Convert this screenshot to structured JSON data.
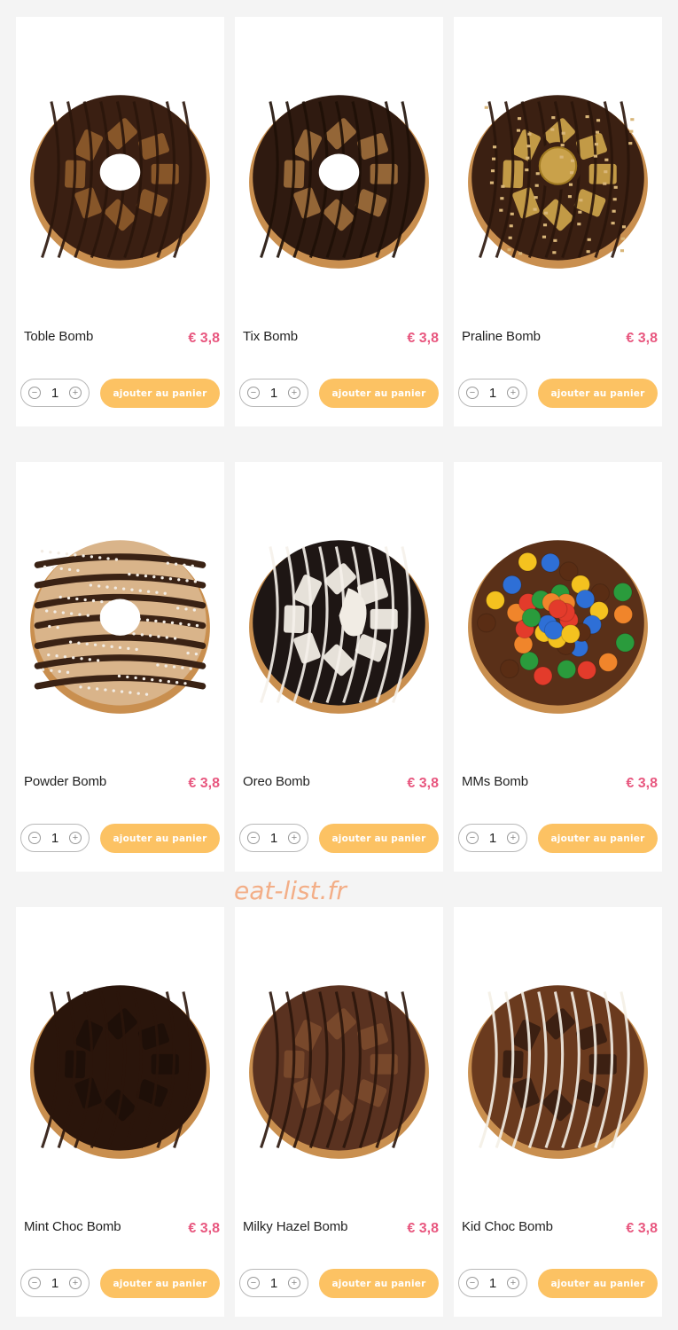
{
  "products": [
    {
      "name": "Toble Bomb",
      "price": "€ 3,8",
      "qty": "1",
      "add_label": "ajouter au panier",
      "image": "toble-bomb-donut",
      "colors": {
        "glaze": "#3a1f12",
        "topping": "#8b5a2b",
        "drizzle": "#2a150b"
      }
    },
    {
      "name": "Tix Bomb",
      "price": "€ 3,8",
      "qty": "1",
      "add_label": "ajouter au panier",
      "image": "tix-bomb-donut",
      "colors": {
        "glaze": "#2f1a10",
        "topping": "#9a6a3a",
        "drizzle": "#1e0f07"
      }
    },
    {
      "name": "Praline Bomb",
      "price": "€ 3,8",
      "qty": "1",
      "add_label": "ajouter au panier",
      "image": "praline-bomb-donut",
      "colors": {
        "glaze": "#3b2012",
        "topping": "#c9a14a",
        "drizzle": "#2a150b"
      }
    },
    {
      "name": "Powder Bomb",
      "price": "€ 3,8",
      "qty": "1",
      "add_label": "ajouter au panier",
      "image": "powder-bomb-donut",
      "colors": {
        "glaze": "#d9b48a",
        "topping": "#f2ece4",
        "drizzle": "#3a2214"
      }
    },
    {
      "name": "Oreo Bomb",
      "price": "€ 3,8",
      "qty": "1",
      "add_label": "ajouter au panier",
      "image": "oreo-bomb-donut",
      "colors": {
        "glaze": "#1e1614",
        "topping": "#f1ece4",
        "drizzle": "#f5f1ea"
      }
    },
    {
      "name": "MMs Bomb",
      "price": "€ 3,8",
      "qty": "1",
      "add_label": "ajouter au panier",
      "image": "mms-bomb-donut",
      "colors": {
        "glaze": "#5a3018",
        "topping": "#e33b2b",
        "drizzle": "#4a2814"
      }
    },
    {
      "name": "Mint Choc Bomb",
      "price": "€ 3,8",
      "qty": "1",
      "add_label": "ajouter au panier",
      "image": "mint-choc-bomb-donut",
      "colors": {
        "glaze": "#2a150b",
        "topping": "#1d0f08",
        "drizzle": "#2a150b"
      }
    },
    {
      "name": "Milky Hazel Bomb",
      "price": "€ 3,8",
      "qty": "1",
      "add_label": "ajouter au panier",
      "image": "milky-hazel-bomb-donut",
      "colors": {
        "glaze": "#5a3220",
        "topping": "#7a4a2c",
        "drizzle": "#2a150b"
      }
    },
    {
      "name": "Kid Choc Bomb",
      "price": "€ 3,8",
      "qty": "1",
      "add_label": "ajouter au panier",
      "image": "kid-choc-bomb-donut",
      "colors": {
        "glaze": "#6a3a1e",
        "topping": "#3a1f12",
        "drizzle": "#f4efe6"
      }
    }
  ],
  "watermark": "eat-list.fr",
  "icons": {
    "minus": "minus-circle-icon",
    "plus": "plus-circle-icon"
  },
  "brand_colors": {
    "price": "#e8577f",
    "add_button": "#fcc263",
    "card": "#ffffff",
    "background": "#f4f4f4"
  }
}
